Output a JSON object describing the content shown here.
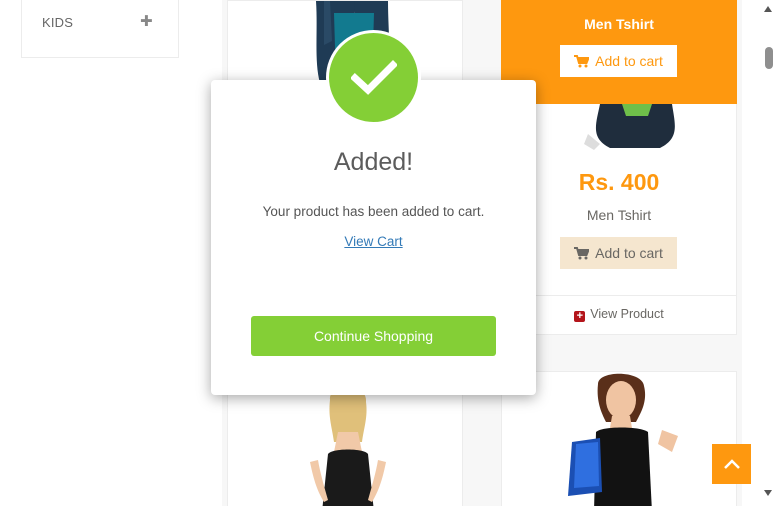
{
  "sidebar": {
    "category_label": "KIDS"
  },
  "products": {
    "top_right": {
      "overlay_name": "Men Tshirt",
      "overlay_button": "Add to cart",
      "price": "Rs. 400",
      "name": "Men Tshirt",
      "add_button": "Add to cart",
      "view_product": "View Product"
    }
  },
  "modal": {
    "title": "Added!",
    "message": "Your product has been added to cart.",
    "view_cart": "View Cart",
    "continue": "Continue Shopping"
  },
  "colors": {
    "accent": "#fe980f",
    "success": "#84cf36",
    "link": "#337ab7"
  },
  "icons": [
    "plus-icon",
    "cart-icon",
    "check-icon",
    "chevron-up-icon"
  ]
}
